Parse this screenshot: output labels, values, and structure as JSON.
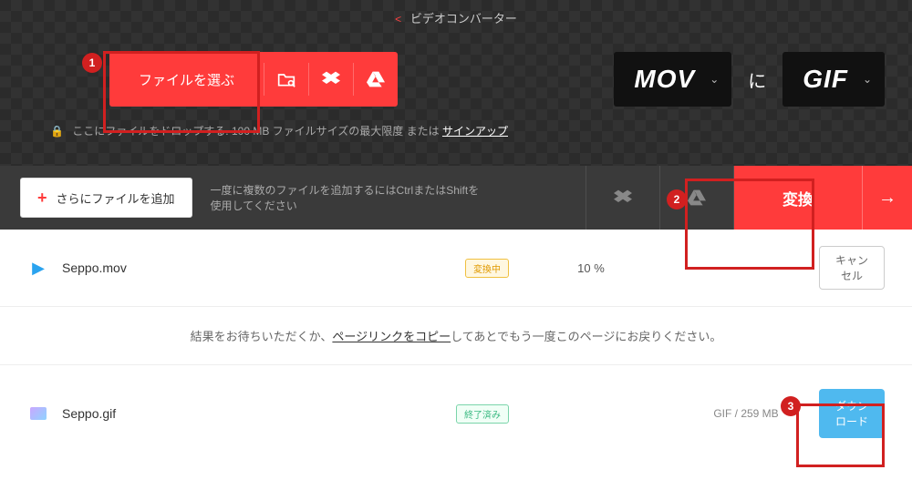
{
  "header": {
    "caret": "<",
    "title": "ビデオコンバーター"
  },
  "picker": {
    "choose_label": "ファイルを選ぶ",
    "from_format": "MOV",
    "to_label": "に",
    "to_format": "GIF"
  },
  "drop_hint": {
    "prefix": "ここにファイルをドロップする. 100 MB ファイルサイズの最大限度 または ",
    "signup": "サインアップ"
  },
  "action_bar": {
    "add_more": "さらにファイルを追加",
    "multi_hint": "一度に複数のファイルを追加するにはCtrlまたはShiftを使用してください",
    "convert": "変換"
  },
  "rows": {
    "converting": {
      "name": "Seppo.mov",
      "badge": "変換中",
      "percent": "10 %",
      "cancel": "キャンセル"
    },
    "waiting": {
      "prefix": "結果をお待ちいただくか、",
      "link": "ページリンクをコピー",
      "suffix": "してあとでもう一度このページにお戻りください。"
    },
    "done": {
      "name": "Seppo.gif",
      "badge": "終了済み",
      "meta": "GIF / 259 MB",
      "download": "ダウンロード"
    }
  },
  "callouts": {
    "c1": "1",
    "c2": "2",
    "c3": "3"
  }
}
